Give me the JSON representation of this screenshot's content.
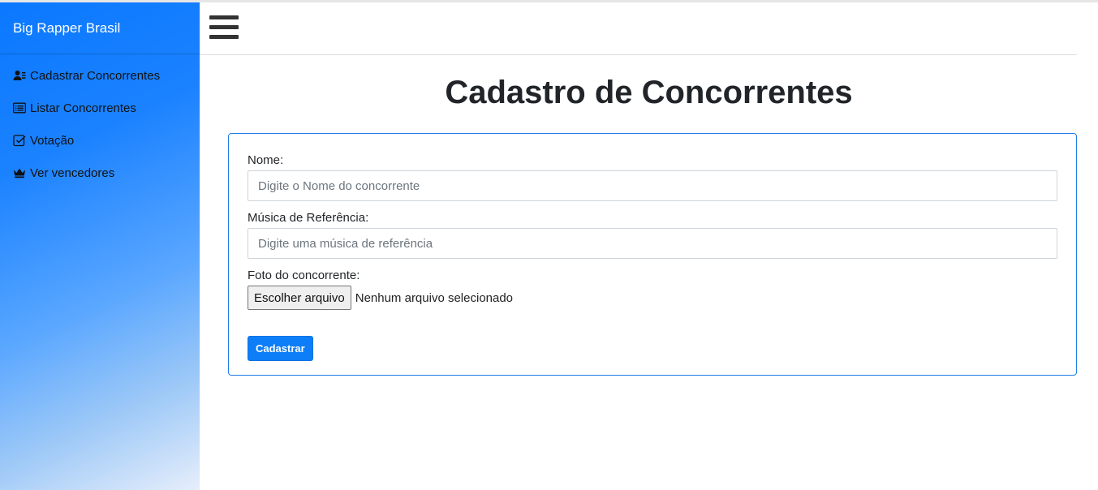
{
  "sidebar": {
    "brand": "Big Rapper Brasil",
    "items": [
      {
        "label": "Cadastrar Concorrentes",
        "icon": "user-list-icon"
      },
      {
        "label": "Listar Concorrentes",
        "icon": "list-icon"
      },
      {
        "label": "Votação",
        "icon": "check-square-icon"
      },
      {
        "label": "Ver vencedores",
        "icon": "crown-icon"
      }
    ]
  },
  "topbar": {
    "menu_icon": "hamburger-icon"
  },
  "main": {
    "title": "Cadastro de Concorrentes",
    "form": {
      "name_label": "Nome:",
      "name_placeholder": "Digite o Nome do concorrente",
      "name_value": "",
      "music_label": "Música de Referência:",
      "music_placeholder": "Digite uma música de referência",
      "music_value": "",
      "photo_label": "Foto do concorrente:",
      "file_button": "Escolher arquivo",
      "file_status": "Nenhum arquivo selecionado",
      "submit_label": "Cadastrar"
    }
  },
  "colors": {
    "accent": "#0d7ef7",
    "sidebar_start": "#0a78ff",
    "sidebar_end": "#e6eefb",
    "card_border": "#1e7ee8"
  }
}
